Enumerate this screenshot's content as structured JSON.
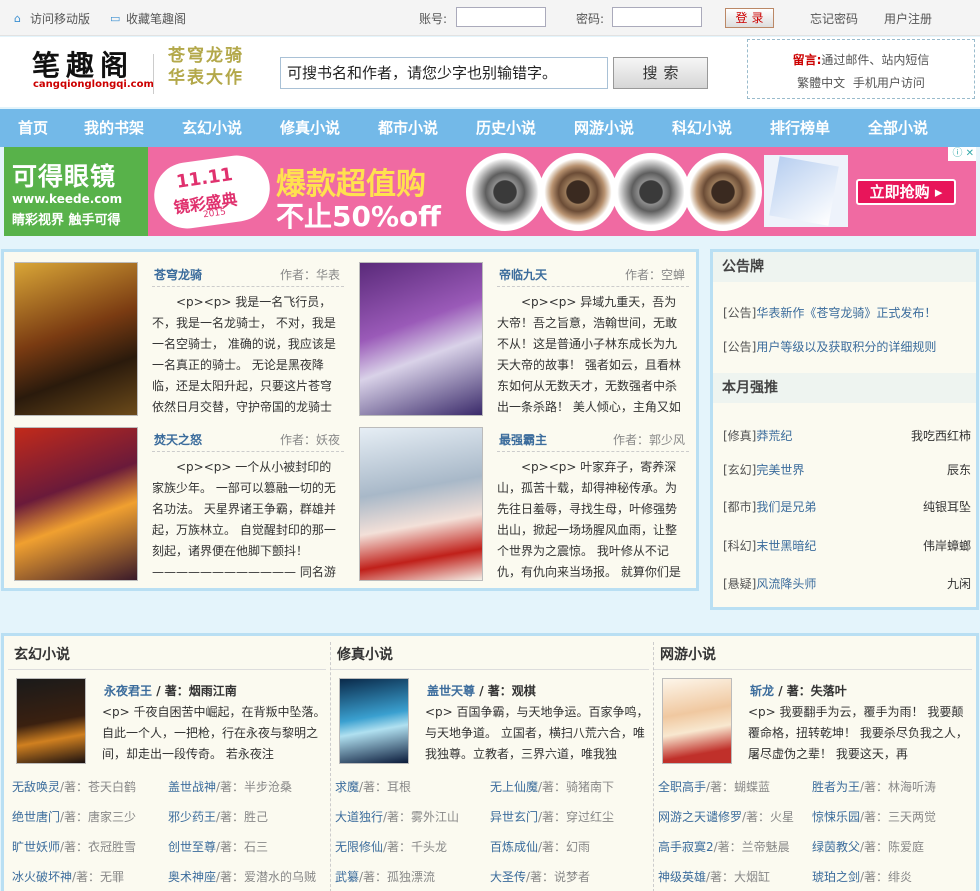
{
  "topbar": {
    "mobile": "访问移动版",
    "bookmark": "收藏笔趣阁",
    "account_label": "账号:",
    "password_label": "密码:",
    "login": "登录",
    "forgot": "忘记密码",
    "register": "用户注册"
  },
  "header": {
    "logo": "笔趣阁",
    "logo_sub": "cangqionglongqi.com",
    "slogan_1": "苍穹龙骑",
    "slogan_2": "华表大作",
    "search_placeholder": "可搜书名和作者，请您少字也别输错字。",
    "search_button": "搜索",
    "notice_label": "留言:",
    "notice_text": "通过邮件、站内短信",
    "trad": "繁體中文",
    "mobile_visit": "手机用户访问"
  },
  "nav": [
    "首页",
    "我的书架",
    "玄幻小说",
    "修真小说",
    "都市小说",
    "历史小说",
    "网游小说",
    "科幻小说",
    "排行榜单",
    "全部小说"
  ],
  "ad": {
    "brand": "可得眼镜",
    "domain": "www.keede.com",
    "tagline": "睛彩视界 触手可得",
    "badge_1": "11.11",
    "badge_2": "镜彩盛典",
    "badge_3": "2015",
    "headline": "爆款超值购",
    "discount": "不止50%off",
    "cta": "立即抢购 ▸",
    "close": "ⓘ ✕"
  },
  "featured": [
    {
      "title": "苍穹龙骑",
      "author": "作者：华表",
      "desc": "<p><p> 我是一名飞行员，不，我是一名龙骑士， 不对，我是一名空骑士， 准确的说，我应该是一名真正的骑士。 无论是黑夜降临，还是太阳升起，只要这片苍穹依然日月交替，守护帝国的龙骑士"
    },
    {
      "title": "帝临九天",
      "author": "作者：空蝉",
      "desc": "<p><p> 异域九重天，吾为大帝！吾之旨意，浩翰世间，无敢不从！这是普通小子林东成长为九天大帝的故事！ 强者如云，且看林东如何从无数天才，无数强者中杀出一条杀路！ 美人倾心，主角又如何选"
    },
    {
      "title": "焚天之怒",
      "author": "作者：妖夜",
      "desc": "<p><p> 一个从小被封印的家族少年。 一部可以篡融一切的无名功法。 天星界诸王争霸，群雄并起，万族林立。 自觉醒封印的那一刻起，诸界便在他脚下颤抖！ ———————————— 同名游戏火热筹备"
    },
    {
      "title": "最强霸主",
      "author": "作者：郭少风",
      "desc": "<p><p> 叶家弃子，寄养深山，孤苦十载，却得神秘传承。为先往日羞辱，寻找生母，叶修强势出山，掀起一场场腥风血雨，让整个世界为之震惊。 我叶修从不记仇，有仇向来当场报。 就算你们是神，"
    }
  ],
  "sidebar": {
    "board_title": "公告牌",
    "board": [
      {
        "tag": "[公告]",
        "text": "华表新作《苍穹龙骑》正式发布！"
      },
      {
        "tag": "[公告]",
        "text": "用户等级以及获取积分的详细规则"
      }
    ],
    "month_title": "本月强推",
    "month": [
      {
        "tag": "[修真]",
        "title": "莽荒纪",
        "author": "我吃西红柿"
      },
      {
        "tag": "[玄幻]",
        "title": "完美世界",
        "author": "辰东"
      },
      {
        "tag": "[都市]",
        "title": "我们是兄弟",
        "author": "纯银耳坠"
      },
      {
        "tag": "[科幻]",
        "title": "末世黑暗纪",
        "author": "伟岸蟑螂"
      },
      {
        "tag": "[悬疑]",
        "title": "风流降头师",
        "author": "九闲"
      }
    ]
  },
  "categories": [
    {
      "name": "玄幻小说",
      "top_title": "永夜君王",
      "top_author": "/ 著：烟雨江南",
      "top_desc": "<p> 千夜自困苦中崛起，在背叛中坠落。 自此一个人，一把枪，行在永夜与黎明之间，却走出一段传奇。 若永夜注",
      "list": [
        {
          "n": "无敌唤灵",
          "a": "/著：苍天白鹤"
        },
        {
          "n": "盖世战神",
          "a": "/著：半步沧桑"
        },
        {
          "n": "绝世唐门",
          "a": "/著：唐家三少"
        },
        {
          "n": "邪少药王",
          "a": "/著：胜己"
        },
        {
          "n": "旷世妖师",
          "a": "/著：衣冠胜雪"
        },
        {
          "n": "创世至尊",
          "a": "/著：石三"
        },
        {
          "n": "冰火破坏神",
          "a": "/著：无罪"
        },
        {
          "n": "奥术神座",
          "a": "/著：爱潜水的乌贼"
        }
      ]
    },
    {
      "name": "修真小说",
      "top_title": "盖世天尊",
      "top_author": "/ 著：观棋",
      "top_desc": "<p> 百国争霸，与天地争运。百家争鸣，与天地争道。 立国者，横扫八荒六合，唯我独尊。立教者，三界六道，唯我独",
      "list": [
        {
          "n": "求魔",
          "a": "/著：耳根"
        },
        {
          "n": "无上仙魔",
          "a": "/著：骑猪南下"
        },
        {
          "n": "大道独行",
          "a": "/著：雾外江山"
        },
        {
          "n": "异世玄门",
          "a": "/著：穿过红尘"
        },
        {
          "n": "无限修仙",
          "a": "/著：千头龙"
        },
        {
          "n": "百炼成仙",
          "a": "/著：幻雨"
        },
        {
          "n": "武纂",
          "a": "/著：孤独漂流"
        },
        {
          "n": "大圣传",
          "a": "/著：说梦者"
        }
      ]
    },
    {
      "name": "网游小说",
      "top_title": "斩龙",
      "top_author": "/ 著：失落叶",
      "top_desc": "<p> 我要翻手为云，覆手为雨！ 我要颠覆命格，扭转乾坤！ 我要杀尽负我之人，屠尽虚伪之辈！ 我要这天，再",
      "list": [
        {
          "n": "全职高手",
          "a": "/著：蝴蝶蓝"
        },
        {
          "n": "胜者为王",
          "a": "/著：林海听涛"
        },
        {
          "n": "网游之天谴修罗",
          "a": "/著：火星"
        },
        {
          "n": "惊悚乐园",
          "a": "/著：三天两觉"
        },
        {
          "n": "高手寂寞2",
          "a": "/著：兰帝魅晨"
        },
        {
          "n": "绿茵教父",
          "a": "/著：陈爱庭"
        },
        {
          "n": "神级英雄",
          "a": "/著：大烟缸"
        },
        {
          "n": "琥珀之剑",
          "a": "/著：绯炎"
        }
      ]
    }
  ]
}
